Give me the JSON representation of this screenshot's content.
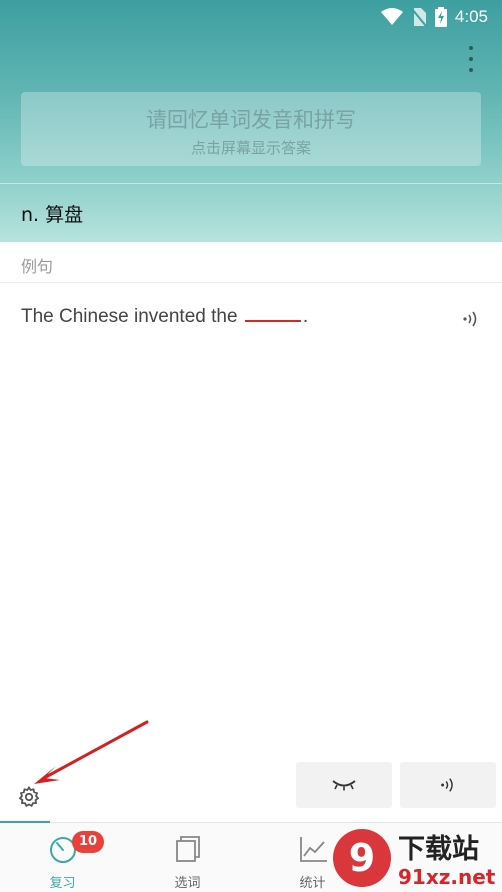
{
  "status_bar": {
    "time": "4:05"
  },
  "prompt": {
    "title": "请回忆单词发音和拼写",
    "subtitle": "点击屏幕显示答案"
  },
  "definition": "n. 算盘",
  "example_section": {
    "label": "例句",
    "sentence_before": "The Chinese invented the ",
    "sentence_after": "."
  },
  "bottom_nav": {
    "items": [
      {
        "label": "复习",
        "icon": "review-timer-icon",
        "badge": "10",
        "active": true
      },
      {
        "label": "选词",
        "icon": "select-words-icon",
        "active": false
      },
      {
        "label": "统计",
        "icon": "stats-chart-icon",
        "active": false
      }
    ]
  },
  "watermark": {
    "brand": "下载站",
    "site": "91xz.net",
    "logo_text": "9"
  },
  "colors": {
    "accent": "#3fa8a4",
    "badge": "#e8403a",
    "blank_underline": "#d62828",
    "annotation_arrow": "#d42020"
  }
}
